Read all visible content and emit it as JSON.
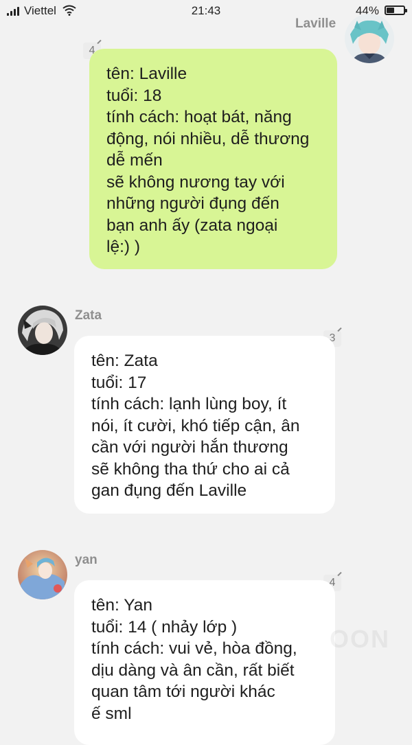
{
  "status_bar": {
    "carrier": "Viettel",
    "time": "21:43",
    "battery_percent": "44%",
    "battery_level": 0.44
  },
  "messages": [
    {
      "sender": "Laville",
      "side": "right",
      "comment_count": "4",
      "lines": [
        "tên: Laville",
        "tuổi: 18",
        "tính cách: hoạt bát, năng",
        "động, nói nhiều, dễ thương",
        "dễ mến",
        "sẽ không nương tay với",
        "những người đụng đến",
        "bạn anh ấy (zata ngoại",
        "lệ:) )"
      ]
    },
    {
      "sender": "Zata",
      "side": "left",
      "comment_count": "3",
      "lines": [
        "tên: Zata",
        "tuổi: 17",
        "tính cách: lạnh lùng boy, ít",
        "nói, ít cười, khó tiếp cận, ân",
        "cần với người hắn thương",
        "sẽ không tha thứ cho ai cả",
        "gan đụng đến Laville"
      ]
    },
    {
      "sender": "yan",
      "side": "left",
      "comment_count": "4",
      "lines": [
        "tên: Yan",
        "tuổi: 14 ( nhảy lớp )",
        "tính cách: vui vẻ, hòa đồng,",
        "dịu dàng và ân cần, rất biết",
        "quan tâm tới người khác",
        "ế sml"
      ]
    }
  ],
  "watermark": "OON"
}
